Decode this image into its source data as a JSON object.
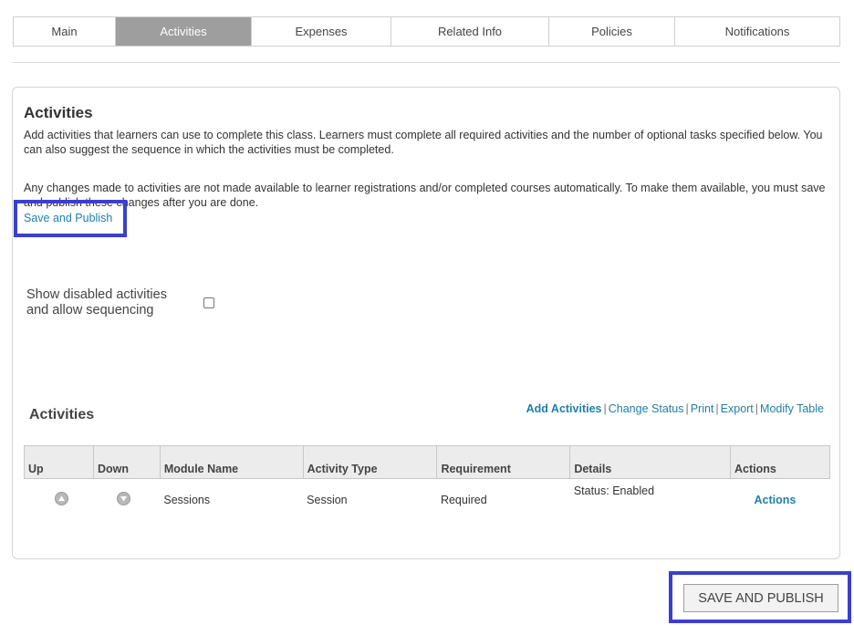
{
  "tabs": [
    {
      "label": "Main",
      "active": false
    },
    {
      "label": "Activities",
      "active": true
    },
    {
      "label": "Expenses",
      "active": false
    },
    {
      "label": "Related Info",
      "active": false
    },
    {
      "label": "Policies",
      "active": false
    },
    {
      "label": "Notifications",
      "active": false
    }
  ],
  "panel": {
    "title": "Activities",
    "description": "Add activities that learners can use to complete this class. Learners must complete all required activities and the number of optional tasks specified below. You can also suggest the sequence in which the activities must be completed.",
    "notice": "Any changes made to activities are not made available to learner registrations and/or completed courses automatically. To make them available, you must save and publish these changes after you are done.",
    "save_link": "Save and Publish",
    "show_disabled_label": "Show disabled activities and allow sequencing",
    "show_disabled_checked": false
  },
  "activities_section": {
    "title": "Activities",
    "links": [
      "Add Activities",
      "Change Status",
      "Print",
      "Export",
      "Modify Table"
    ]
  },
  "table": {
    "headers": [
      "Up",
      "Down",
      "Module Name",
      "Activity Type",
      "Requirement",
      "Details",
      "Actions"
    ],
    "rows": [
      {
        "module_name": "Sessions",
        "activity_type": "Session",
        "requirement": "Required",
        "details": "Status: Enabled",
        "actions": "Actions"
      }
    ]
  },
  "footer": {
    "save_button": "SAVE AND PUBLISH"
  },
  "colors": {
    "active_tab": "#9e9e9e",
    "link": "#1f7fa8",
    "highlight": "#3a3fd0"
  }
}
